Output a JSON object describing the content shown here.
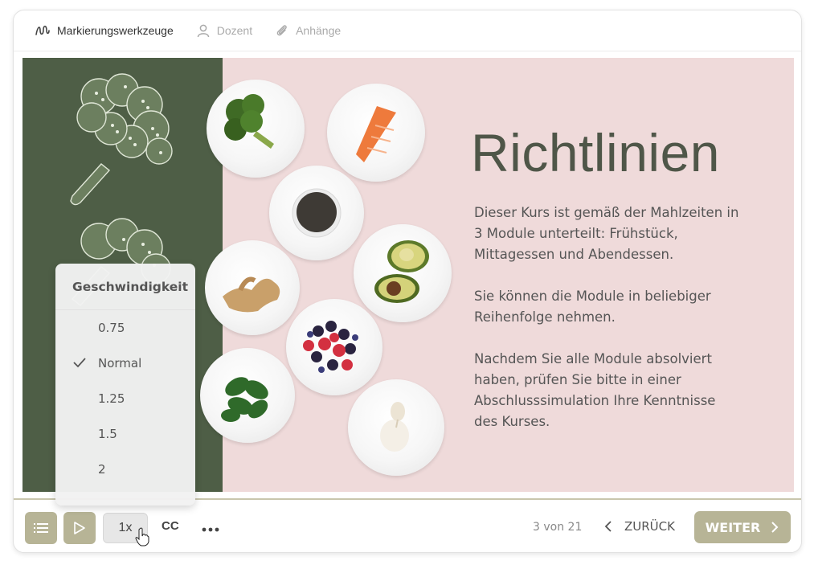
{
  "tabs": [
    {
      "label": "Markierungswerkzeuge",
      "icon": "squiggle-icon",
      "active": true
    },
    {
      "label": "Dozent",
      "icon": "person-icon",
      "active": false
    },
    {
      "label": "Anhänge",
      "icon": "paperclip-icon",
      "active": false
    }
  ],
  "slide": {
    "title": "Richtlinien",
    "paragraphs": [
      "Dieser Kurs ist gemäß der Mahlzeiten in 3 Module unterteilt: Frühstück, Mittagessen und Abendessen.",
      "Sie können die Module in beliebiger Reihenfolge nehmen.",
      "Nachdem Sie alle Module absolviert haben, prüfen Sie bitte in einer Abschlusssimulation Ihre Kenntnisse des Kurses."
    ],
    "colors": {
      "panel": "#4e5e46",
      "background": "#efdada",
      "title": "#4f5648"
    }
  },
  "speed_menu": {
    "title": "Geschwindigkeit",
    "options": [
      "0.75",
      "Normal",
      "1.25",
      "1.5",
      "2"
    ],
    "selected": "Normal"
  },
  "controls": {
    "speed_label": "1x",
    "cc_label": "CC",
    "more_label": "•••",
    "page_status": "3 von 21",
    "back_label": "ZURÜCK",
    "next_label": "WEITER",
    "accent": "#b7b496"
  }
}
